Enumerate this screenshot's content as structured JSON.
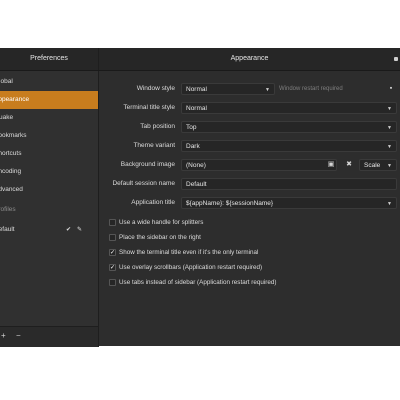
{
  "titlebar": {
    "left_title": "Preferences",
    "right_title": "Appearance"
  },
  "sidebar": {
    "items": [
      {
        "label": "Global"
      },
      {
        "label": "Appearance"
      },
      {
        "label": "Quake"
      },
      {
        "label": "Bookmarks"
      },
      {
        "label": "Shortcuts"
      },
      {
        "label": "Encoding"
      },
      {
        "label": "Advanced"
      },
      {
        "label": "Profiles"
      },
      {
        "label": "Default"
      }
    ],
    "default_icons": {
      "check": "✔",
      "edit": "✎"
    }
  },
  "bottombar": {
    "add_label": "+",
    "remove_label": "−"
  },
  "appearance": {
    "window_style_label": "Window style",
    "window_style_value": "Normal",
    "window_style_hint": "Window restart required",
    "terminal_title_style_label": "Terminal title style",
    "terminal_title_style_value": "Normal",
    "tab_position_label": "Tab position",
    "tab_position_value": "Top",
    "theme_variant_label": "Theme variant",
    "theme_variant_value": "Dark",
    "background_image_label": "Background image",
    "background_image_value": "(None)",
    "background_image_mode": "Scale",
    "default_session_name_label": "Default session name",
    "default_session_name_value": "Default",
    "application_title_label": "Application title",
    "application_title_value": "${appName}: ${sessionName}",
    "checkboxes": [
      {
        "label": "Use a wide handle for splitters",
        "checked": false
      },
      {
        "label": "Place the sidebar on the right",
        "checked": false
      },
      {
        "label": "Show the terminal title even if it's the only terminal",
        "checked": true
      },
      {
        "label": "Use overlay scrollbars (Application restart required)",
        "checked": true
      },
      {
        "label": "Use tabs instead of sidebar (Application restart required)",
        "checked": false
      }
    ]
  },
  "icons": {
    "dropdown": "chevron-down-icon",
    "image": "image-icon",
    "clear": "clear-icon",
    "menu": "menu-icon"
  }
}
